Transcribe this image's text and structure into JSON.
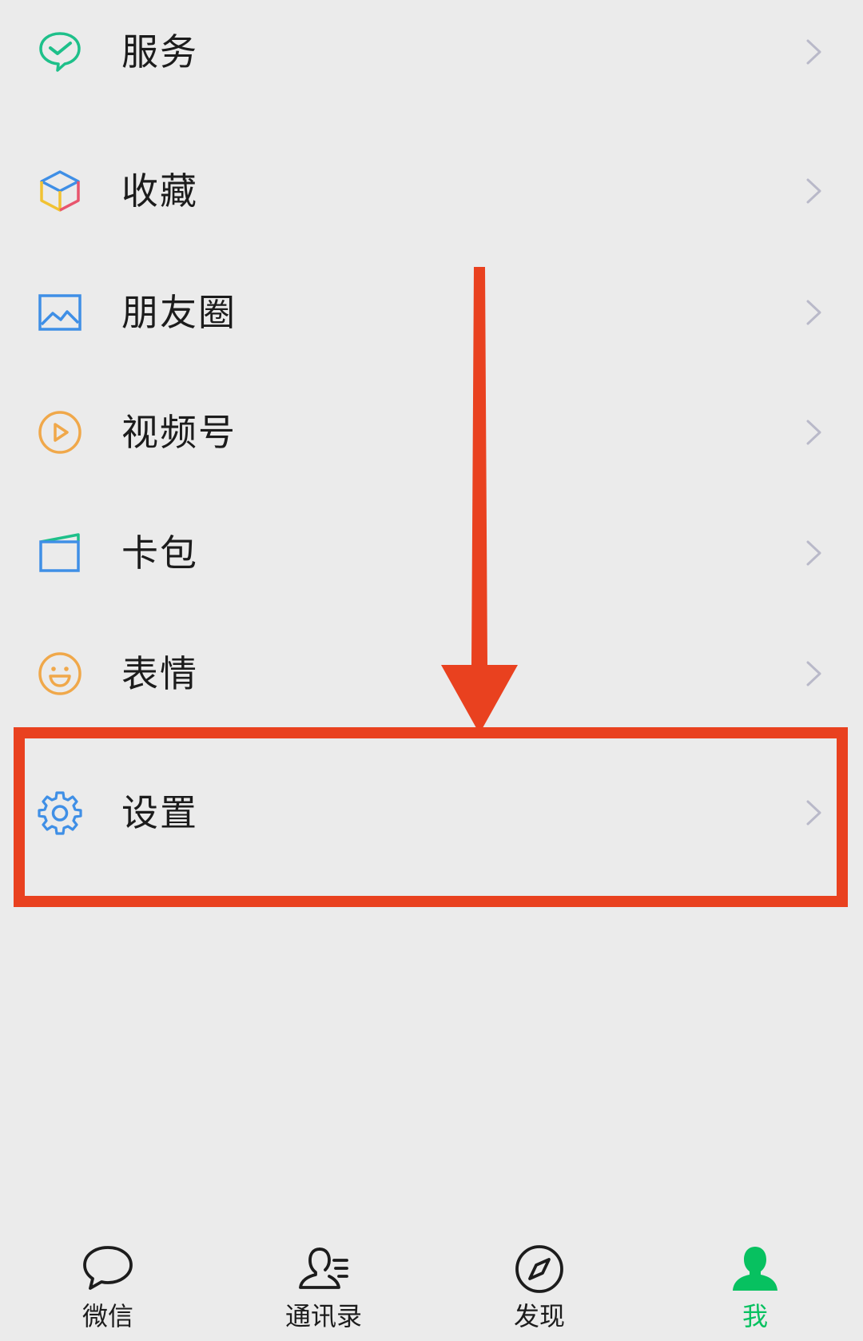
{
  "colors": {
    "accent": "#07c160",
    "highlight": "#e9411f",
    "chevron": "#b9b9c9"
  },
  "menu": {
    "items": [
      {
        "label": "服务",
        "icon": "service-check-icon"
      },
      {
        "label": "收藏",
        "icon": "favorites-cube-icon"
      },
      {
        "label": "朋友圈",
        "icon": "moments-photo-icon"
      },
      {
        "label": "视频号",
        "icon": "channels-play-icon"
      },
      {
        "label": "卡包",
        "icon": "cards-wallet-icon"
      },
      {
        "label": "表情",
        "icon": "stickers-smiley-icon"
      },
      {
        "label": "设置",
        "icon": "settings-gear-icon"
      }
    ]
  },
  "tabbar": {
    "tabs": [
      {
        "label": "微信",
        "icon": "chat-bubble-icon",
        "active": false
      },
      {
        "label": "通讯录",
        "icon": "contacts-icon",
        "active": false
      },
      {
        "label": "发现",
        "icon": "compass-icon",
        "active": false
      },
      {
        "label": "我",
        "icon": "person-icon",
        "active": true
      }
    ]
  }
}
